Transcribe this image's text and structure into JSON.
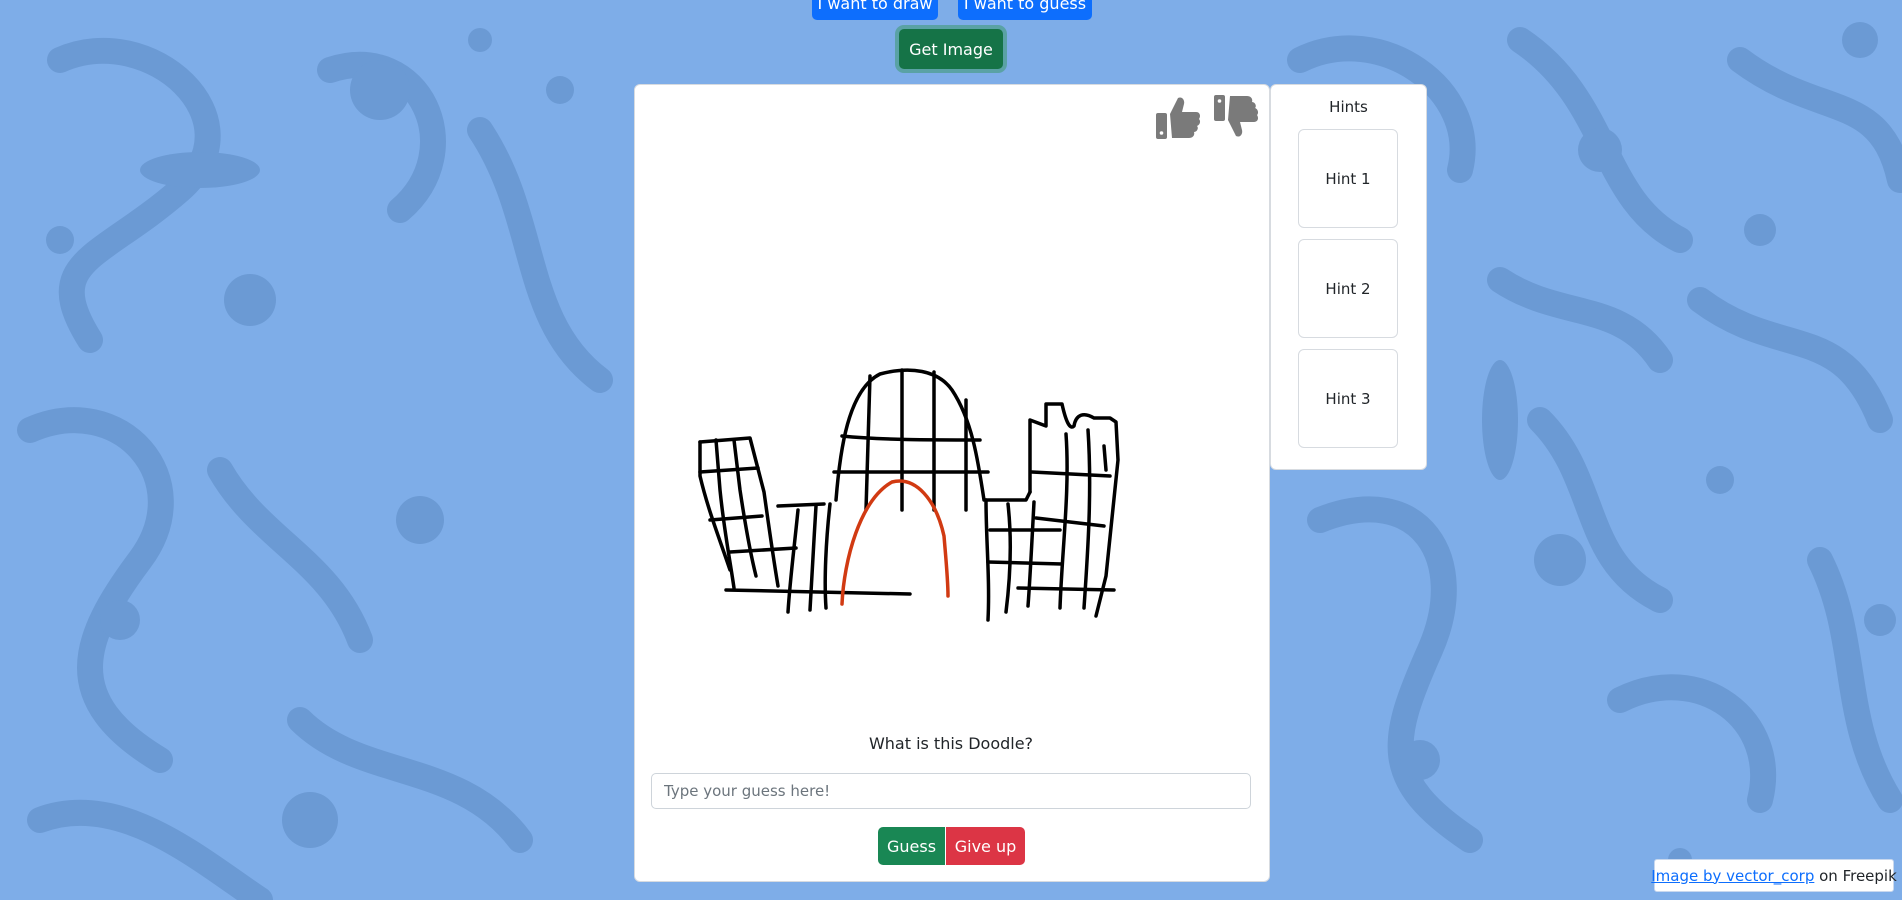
{
  "colors": {
    "background": "#7eade8",
    "pattern": "#6b9ad4",
    "primary": "#0d6efd",
    "success": "#198754",
    "danger": "#dc3545",
    "doodle_black": "#000000",
    "doodle_red": "#d13a12",
    "thumb_icon": "#7a7a7a"
  },
  "mode_buttons": {
    "draw_label": "I want to draw",
    "guess_label": "I want to guess"
  },
  "get_image_label": "Get Image",
  "feedback": {
    "like_icon": "thumbs-up-icon",
    "dislike_icon": "thumbs-down-icon"
  },
  "question": "What is this Doodle?",
  "guess_input": {
    "placeholder": "Type your guess here!",
    "value": ""
  },
  "actions": {
    "guess_label": "Guess",
    "give_up_label": "Give up"
  },
  "hints": {
    "title": "Hints",
    "items": [
      "Hint 1",
      "Hint 2",
      "Hint 3"
    ]
  },
  "attribution": {
    "link_text": "Image by vector_corp",
    "suffix": " on Freepik"
  }
}
